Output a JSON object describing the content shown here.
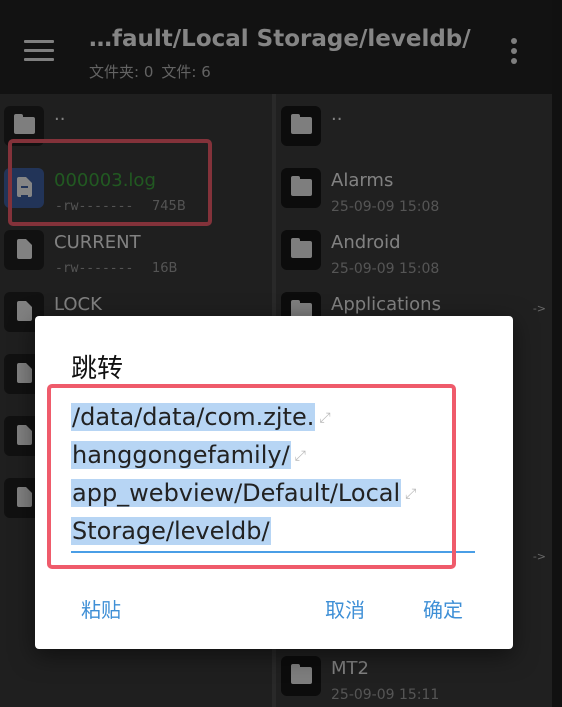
{
  "toolbar": {
    "path_title": "…fault/Local Storage/leveldb/",
    "folders_label": "文件夹: 0",
    "files_label": "文件: 6",
    "menu_icon": "hamburger-menu-icon",
    "more_icon": "more-vertical-icon"
  },
  "left_pane": {
    "items": [
      {
        "name": "..",
        "type": "folder"
      },
      {
        "name": "000003.log",
        "type": "file",
        "permissions": "-rw-------",
        "size": "745B",
        "selected": true
      },
      {
        "name": "CURRENT",
        "type": "file",
        "permissions": "-rw-------",
        "size": "16B"
      },
      {
        "name": "LOCK",
        "type": "file"
      },
      {
        "name": "",
        "type": "file"
      },
      {
        "name": "",
        "type": "file"
      },
      {
        "name": "",
        "type": "file"
      }
    ]
  },
  "right_pane": {
    "items": [
      {
        "name": "..",
        "type": "folder"
      },
      {
        "name": "Alarms",
        "type": "folder",
        "date": "25-09-09 15:08"
      },
      {
        "name": "Android",
        "type": "folder",
        "date": "25-09-09 15:08"
      },
      {
        "name": "Applications",
        "type": "folder",
        "arrow": "->"
      },
      {
        "name": "",
        "type": "folder",
        "arrow": "->"
      },
      {
        "name": "MT2",
        "type": "folder",
        "date": "25-09-09 15:11"
      }
    ]
  },
  "dialog": {
    "title": "跳转",
    "path_lines": [
      "/data/data/com.zjte.",
      "hanggongefamily/",
      "app_webview/Default/Local",
      "Storage/leveldb/"
    ],
    "wrap_mark": "⤢",
    "paste_label": "粘贴",
    "cancel_label": "取消",
    "ok_label": "确定"
  },
  "colors": {
    "toolbar_bg": "#212121",
    "accent": "#3e8fd6",
    "highlight": "#ef5b6b",
    "selected_name": "#3da33d",
    "selection_bg": "#b7d5f4"
  }
}
